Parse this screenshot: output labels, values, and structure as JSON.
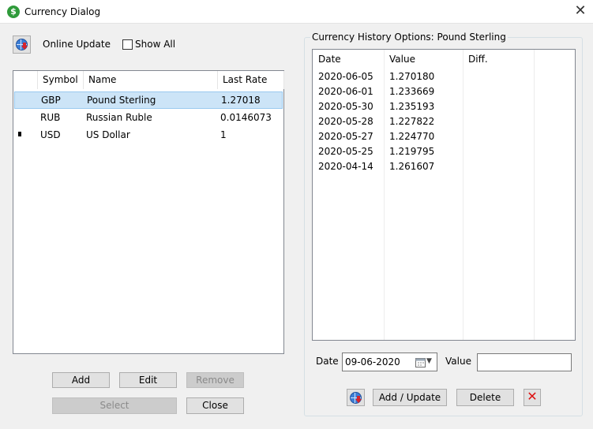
{
  "window": {
    "title": "Currency Dialog",
    "icon_symbol": "$"
  },
  "toolbar": {
    "online_update_label": "Online Update",
    "show_all_label": "Show All",
    "show_all_checked": false
  },
  "currency_table": {
    "columns": [
      "Symbol",
      "Name",
      "Last Rate"
    ],
    "rows": [
      {
        "symbol": "GBP",
        "name": "Pound Sterling",
        "rate": "1.27018",
        "selected": true
      },
      {
        "symbol": "RUB",
        "name": "Russian Ruble",
        "rate": "0.0146073"
      },
      {
        "symbol": "USD",
        "name": "US Dollar",
        "rate": "1",
        "base_marker": true
      }
    ]
  },
  "buttons": {
    "add": "Add",
    "edit": "Edit",
    "remove": "Remove",
    "select": "Select",
    "close": "Close"
  },
  "history": {
    "group_title": "Currency History Options: Pound Sterling",
    "columns": [
      "Date",
      "Value",
      "Diff."
    ],
    "rows": [
      {
        "date": "2020-06-05",
        "value": "1.270180"
      },
      {
        "date": "2020-06-01",
        "value": "1.233669"
      },
      {
        "date": "2020-05-30",
        "value": "1.235193"
      },
      {
        "date": "2020-05-28",
        "value": "1.227822"
      },
      {
        "date": "2020-05-27",
        "value": "1.224770"
      },
      {
        "date": "2020-05-25",
        "value": "1.219795"
      },
      {
        "date": "2020-04-14",
        "value": "1.261607"
      }
    ],
    "date_label": "Date",
    "date_value": "09-06-2020",
    "value_label": "Value",
    "value_input": "",
    "add_update_label": "Add / Update",
    "delete_label": "Delete"
  }
}
